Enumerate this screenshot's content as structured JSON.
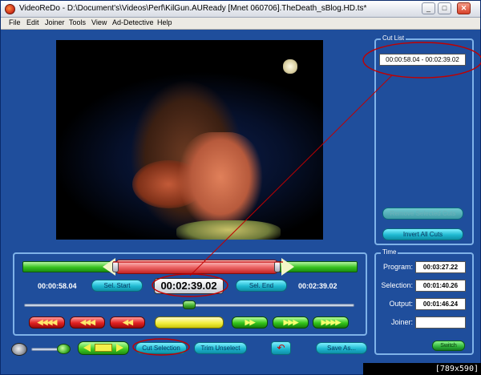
{
  "titlebar": {
    "title": "VideoReDo - D:\\Document's\\Videos\\Perf\\KilGun.AUReady [Mnet 060706].TheDeath_sBlog.HD.ts*",
    "minimize": "_",
    "maximize": "□",
    "close": "✕"
  },
  "menu": [
    "File",
    "Edit",
    "Joiner",
    "Tools",
    "View",
    "Ad-Detective",
    "Help"
  ],
  "cutlist": {
    "legend": "Cut List",
    "entries": [
      "00:00:58.04 - 00:02:39.02"
    ],
    "remove_label": "Remove Selected Cuts",
    "invert_label": "Invert All Cuts"
  },
  "time": {
    "legend": "Time",
    "program_label": "Program:",
    "program_value": "00:03:27.22",
    "selection_label": "Selection:",
    "selection_value": "00:01:40.26",
    "output_label": "Output:",
    "output_value": "00:01:46.24",
    "joiner_label": "Joiner:",
    "joiner_value": "",
    "switch_label": "Switch"
  },
  "editor": {
    "start_time": "00:00:58.04",
    "sel_start_label": "Sel. Start",
    "current_time": "00:02:39.02",
    "sel_end_label": "Sel. End",
    "end_time": "00:02:39.02"
  },
  "nav": {
    "back4": "◀◀◀◀",
    "back3": "◀◀◀",
    "back2": "◀◀",
    "fwd2": "▶▶",
    "fwd3": "▶▶▶",
    "fwd4": "▶▶▶▶"
  },
  "bottom": {
    "cut_selection_label": "Cut Selection",
    "trim_unselect_label": "Trim Unselect",
    "save_as_label": "Save As..."
  },
  "watermark": "[789x590] http://upic.me/",
  "colors": {
    "window_bg": "#1f4e9c",
    "panel_border": "#7fb2e8",
    "annotation": "#c00000"
  }
}
